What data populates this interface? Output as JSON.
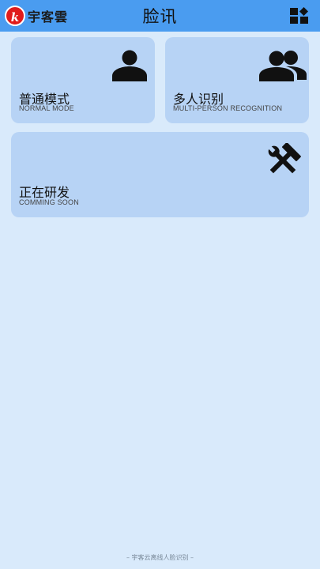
{
  "header": {
    "logo_mark": "k",
    "logo_text": "宇客雲",
    "title": "脸讯",
    "grid_icon": "dashboard-grid-icon"
  },
  "cards": [
    {
      "title": "普通模式",
      "subtitle": "NORMAL MODE",
      "icon": "person-icon"
    },
    {
      "title": "多人识别",
      "subtitle": "MULTI-PERSON RECOGNITION",
      "icon": "group-icon"
    },
    {
      "title": "正在研发",
      "subtitle": "COMMING SOON",
      "icon": "tools-icon"
    }
  ],
  "footer": {
    "text": "– 宇客云离线人脸识别 –"
  },
  "colors": {
    "header": "#4a9cf0",
    "card": "#b7d3f5",
    "background": "#d9eafb",
    "logo_red": "#e01b1b"
  }
}
